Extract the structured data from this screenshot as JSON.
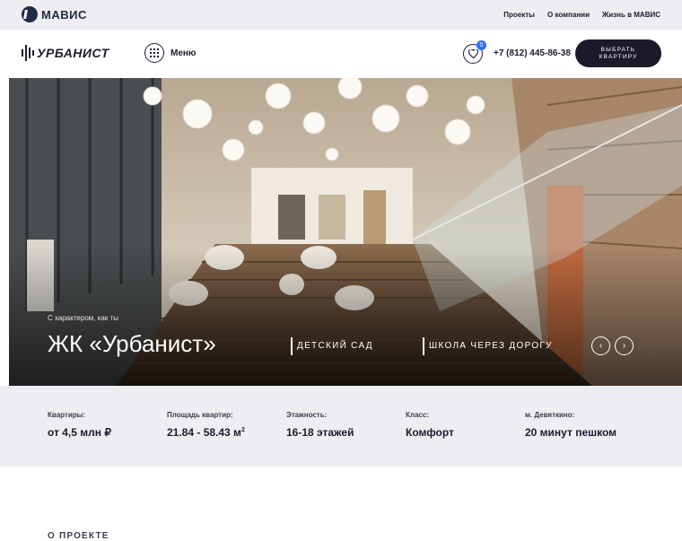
{
  "topbar": {
    "brand": "МАВИС",
    "nav": [
      "Проекты",
      "О компании",
      "Жизнь в МАВИС"
    ]
  },
  "header": {
    "logo": "УРБАНИСТ",
    "menu_label": "Меню",
    "favorites_count": "0",
    "phone": "+7 (812) 445-86-38",
    "cta": "ВЫБРАТЬ КВАРТИРУ"
  },
  "hero": {
    "subtitle": "С характером, как ты",
    "title": "ЖК «Урбанист»",
    "tags": [
      "ДЕТСКИЙ САД",
      "ШКОЛА ЧЕРЕЗ ДОРОГУ"
    ],
    "prev_symbol": "‹",
    "next_symbol": "›"
  },
  "stats": [
    {
      "label": "Квартиры:",
      "value": "от 4,5 млн ₽"
    },
    {
      "label": "Площадь квартир:",
      "value": "21.84 - 58.43 м",
      "sup": "2"
    },
    {
      "label": "Этажность:",
      "value": "16-18 этажей"
    },
    {
      "label": "Класс:",
      "value": "Комфорт"
    },
    {
      "label": "м. Девяткино:",
      "value": "20 минут пешком"
    }
  ],
  "about": {
    "heading": "О ПРОЕКТЕ"
  },
  "colors": {
    "accent_dark": "#1a1a2b",
    "badge": "#2f6bff",
    "light_bg": "#eeedf2"
  }
}
